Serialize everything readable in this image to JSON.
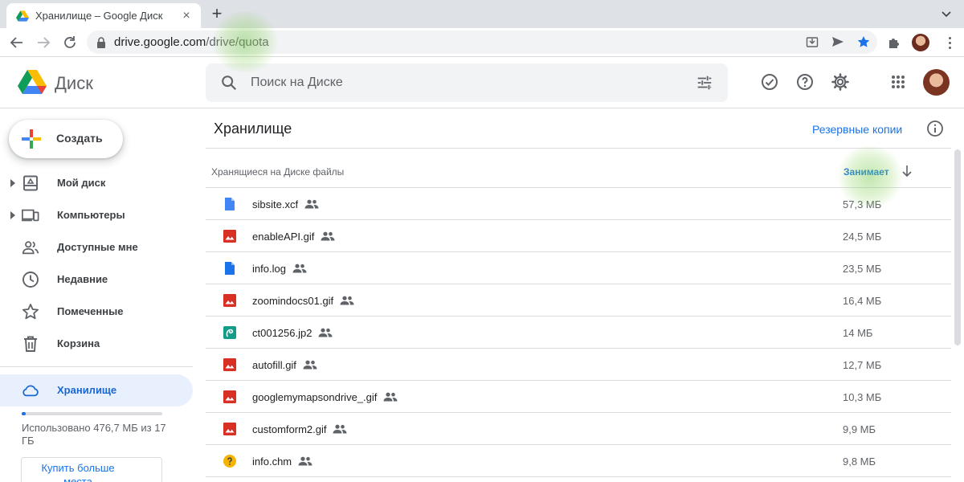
{
  "browser": {
    "tab_title": "Хранилище – Google Диск",
    "url_host": "drive.google.com",
    "url_path": "/drive/quota"
  },
  "header": {
    "logo_text": "Диск",
    "search_placeholder": "Поиск на Диске"
  },
  "sidebar": {
    "create_label": "Создать",
    "items": [
      {
        "label": "Мой диск",
        "icon": "my-drive-icon",
        "expandable": true
      },
      {
        "label": "Компьютеры",
        "icon": "computers-icon",
        "expandable": true
      },
      {
        "label": "Доступные мне",
        "icon": "shared-with-me-icon",
        "expandable": false
      },
      {
        "label": "Недавние",
        "icon": "clock-icon",
        "expandable": false
      },
      {
        "label": "Помеченные",
        "icon": "star-icon",
        "expandable": false
      },
      {
        "label": "Корзина",
        "icon": "trash-icon",
        "expandable": false
      }
    ],
    "storage_label": "Хранилище",
    "quota_text": "Использовано 476,7 МБ из 17 ГБ",
    "quota_fraction": 0.028,
    "buy_button_label": "Купить больше места"
  },
  "main": {
    "title": "Хранилище",
    "backup_link": "Резервные копии",
    "column_name": "Хранящиеся на Диске файлы",
    "column_size": "Занимает",
    "files": [
      {
        "name": "sibsite.xcf",
        "size": "57,3 МБ",
        "type": "doc-light"
      },
      {
        "name": "enableAPI.gif",
        "size": "24,5 МБ",
        "type": "image"
      },
      {
        "name": "info.log",
        "size": "23,5 МБ",
        "type": "doc"
      },
      {
        "name": "zoomindocs01.gif",
        "size": "16,4 МБ",
        "type": "image"
      },
      {
        "name": "ct001256.jp2",
        "size": "14 МБ",
        "type": "drawing"
      },
      {
        "name": "autofill.gif",
        "size": "12,7 МБ",
        "type": "image"
      },
      {
        "name": "googlemymapsondrive_.gif",
        "size": "10,3 МБ",
        "type": "image"
      },
      {
        "name": "customform2.gif",
        "size": "9,9 МБ",
        "type": "image"
      },
      {
        "name": "info.chm",
        "size": "9,8 МБ",
        "type": "unknown"
      }
    ]
  },
  "colors": {
    "accent": "#1a73e8",
    "image_icon": "#d93025",
    "doc_icon": "#4285f4",
    "drawing_icon": "#129c89",
    "unknown_icon": "#f4b400"
  }
}
